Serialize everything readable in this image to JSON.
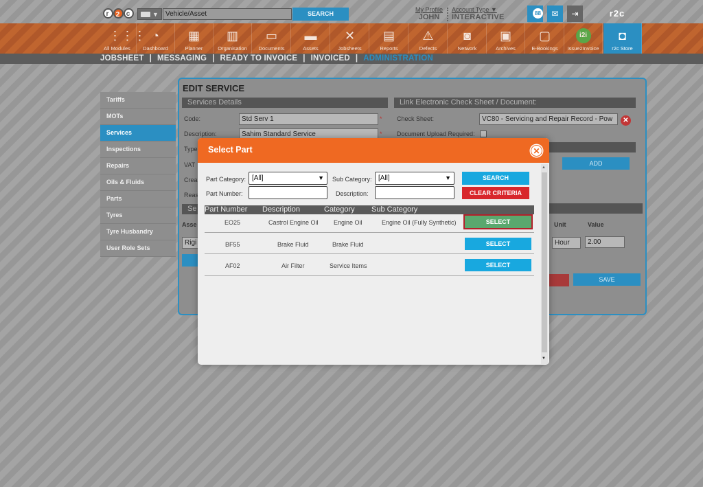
{
  "header": {
    "logo_text": "r2c",
    "vehicle_asset_value": "Vehicle/Asset",
    "search_label": "SEARCH",
    "profile_link": "My Profile",
    "profile_name": "JOHN",
    "account_type_link": "Account Type",
    "account_type_value": "INTERACTIVE",
    "notifications_count": "88"
  },
  "modules": [
    {
      "label": "All Modules",
      "icon": "grid-icon"
    },
    {
      "label": "Dashboard",
      "icon": "speedometer-icon"
    },
    {
      "label": "Planner",
      "icon": "calendar-icon"
    },
    {
      "label": "Organisation",
      "icon": "building-icon"
    },
    {
      "label": "Documents",
      "icon": "folder-icon"
    },
    {
      "label": "Assets",
      "icon": "truck-icon"
    },
    {
      "label": "Jobsheets",
      "icon": "tools-icon"
    },
    {
      "label": "Reports",
      "icon": "clipboard-icon"
    },
    {
      "label": "Defects",
      "icon": "warning-icon"
    },
    {
      "label": "Network",
      "icon": "contacts-icon"
    },
    {
      "label": "Archives",
      "icon": "archive-icon"
    },
    {
      "label": "E-Bookings",
      "icon": "monitor-icon"
    },
    {
      "label": "Issue2Invoice",
      "icon": "i2i-icon"
    },
    {
      "label": "r2c Store",
      "icon": "briefcase-icon"
    }
  ],
  "subnav": [
    "JOBSHEET",
    "MESSAGING",
    "READY TO INVOICE",
    "INVOICED",
    "ADMINISTRATION"
  ],
  "subnav_separator": "|",
  "sidebar": [
    "Tariffs",
    "MOTs",
    "Services",
    "Inspections",
    "Repairs",
    "Oils & Fluids",
    "Parts",
    "Tyres",
    "Tyre Husbandry",
    "User Role Sets"
  ],
  "edit_service": {
    "title": "EDIT SERVICE",
    "services_details_header": "Services Details",
    "link_header": "Link Electronic Check Sheet / Document:",
    "code_label": "Code:",
    "code_value": "Std Serv 1",
    "description_label": "Description:",
    "description_value": "Sahim Standard Service",
    "type_label": "Type",
    "vat_label": "VAT",
    "created_label": "Crea",
    "reason_label": "Reas",
    "section_label": "Se",
    "asset_label": "Asse",
    "rigid_value": "Rigi",
    "check_sheet_label": "Check Sheet:",
    "check_sheet_value": "VC80 - Servicing and Repair Record - Pow",
    "doc_upload_label": "Document Upload Required:",
    "add_label": "ADD",
    "unit_header": "Unit",
    "value_header": "Value",
    "unit_value": "Hour",
    "value_value": "2.00",
    "save_label": "SAVE",
    "required_mark": "*"
  },
  "modal": {
    "title": "Select Part",
    "part_category_label": "Part Category:",
    "part_category_value": "[All]",
    "sub_category_label": "Sub Category:",
    "sub_category_value": "[All]",
    "part_number_label": "Part Number:",
    "description_label": "Description:",
    "search_label": "SEARCH",
    "clear_label": "CLEAR CRITERIA",
    "columns": [
      "Part Number",
      "Description",
      "Category",
      "Sub Category"
    ],
    "select_label": "SELECT",
    "rows": [
      {
        "part_number": "EO25",
        "description": "Castrol Engine Oil",
        "category": "Engine Oil",
        "sub_category": "Engine Oil (Fully Synthetic)"
      },
      {
        "part_number": "BF55",
        "description": "Brake Fluid",
        "category": "Brake Fluid",
        "sub_category": ""
      },
      {
        "part_number": "AF02",
        "description": "Air Filter",
        "category": "Service Items",
        "sub_category": ""
      }
    ]
  },
  "colors": {
    "brand_orange": "#ef6922",
    "accent_blue": "#18a8df",
    "danger_red": "#d8262b",
    "select_highlight": "#5aa86e"
  }
}
